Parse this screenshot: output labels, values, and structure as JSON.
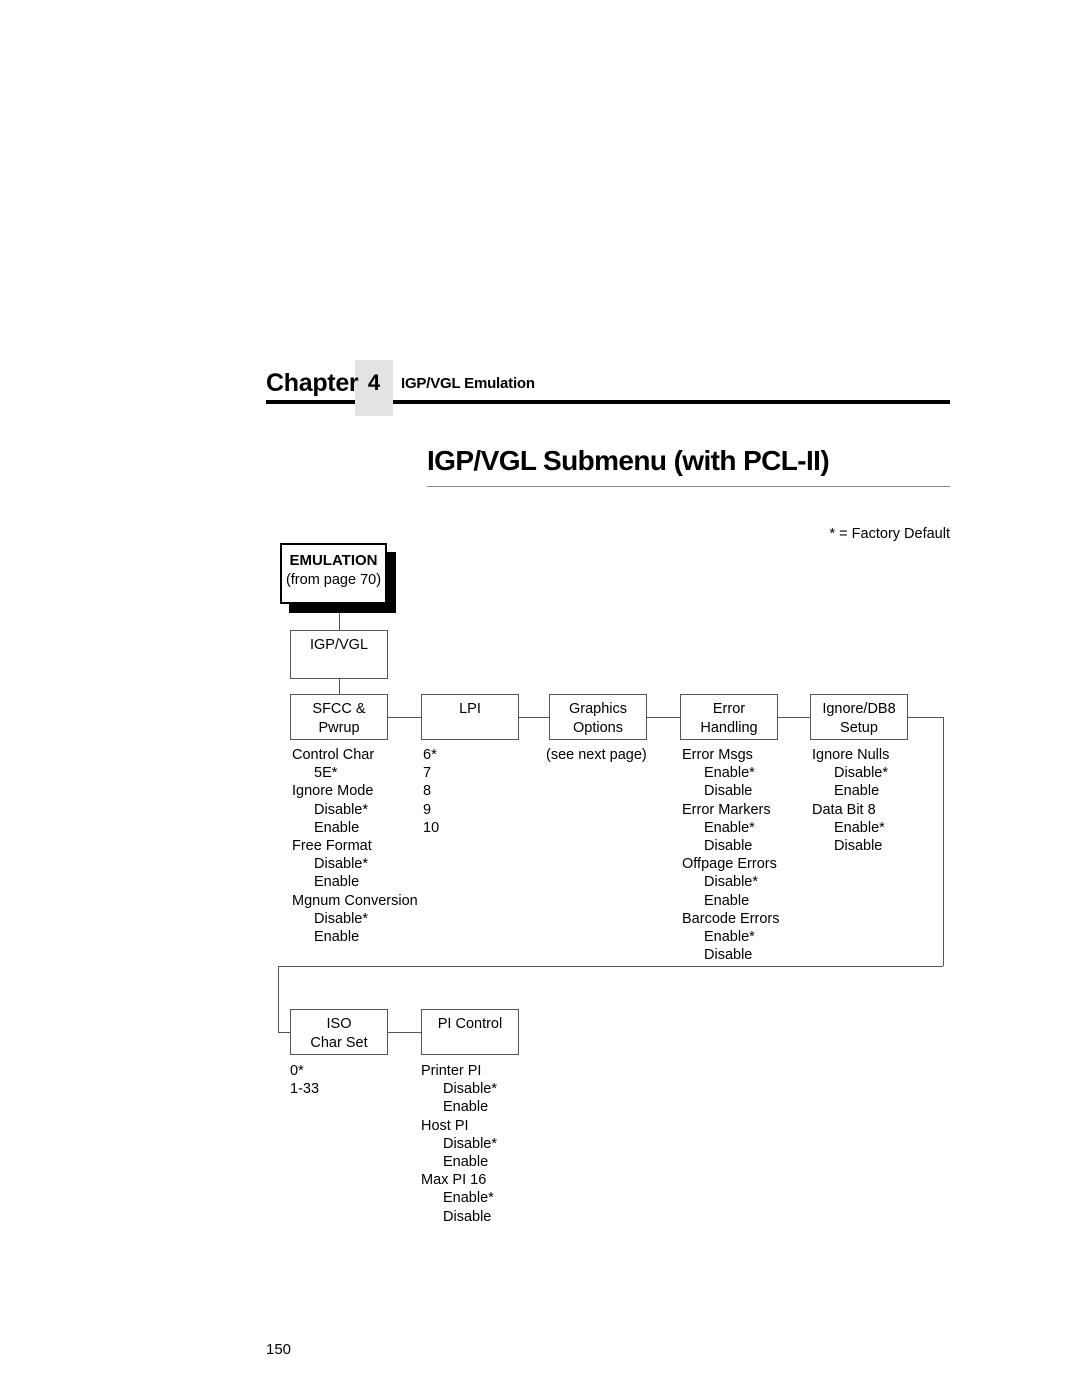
{
  "header": {
    "chapter_word": "Chapter",
    "chapter_number": "4",
    "chapter_title": "IGP/VGL Emulation"
  },
  "page": {
    "title": "IGP/VGL Submenu (with PCL-II)",
    "folio": "150",
    "legend_note": "* = Factory Default"
  },
  "diagram": {
    "root": {
      "label_line1": "EMULATION",
      "label_line2": "(from page 70)"
    },
    "branch": {
      "label_line1": "IGP/VGL",
      "label_line2": ""
    },
    "nodes": [
      {
        "id": "sfcc-pwrup",
        "line1": "SFCC &",
        "line2": "Pwrup"
      },
      {
        "id": "lpi",
        "line1": "LPI",
        "line2": ""
      },
      {
        "id": "graphics-options",
        "line1": "Graphics",
        "line2": "Options"
      },
      {
        "id": "error-handling",
        "line1": "Error",
        "line2": "Handling"
      },
      {
        "id": "ignore-db8-setup",
        "line1": "Ignore/DB8",
        "line2": "Setup"
      },
      {
        "id": "iso-char-set",
        "line1": "ISO",
        "line2": "Char Set"
      },
      {
        "id": "pi-control",
        "line1": "PI Control",
        "line2": ""
      }
    ],
    "columns": {
      "sfcc_pwrup": [
        {
          "text": "Control Char",
          "sub": false
        },
        {
          "text": "5E*",
          "sub": true
        },
        {
          "text": "Ignore Mode",
          "sub": false
        },
        {
          "text": "Disable*",
          "sub": true
        },
        {
          "text": "Enable",
          "sub": true
        },
        {
          "text": "Free Format",
          "sub": false
        },
        {
          "text": "Disable*",
          "sub": true
        },
        {
          "text": "Enable",
          "sub": true
        },
        {
          "text": "Mgnum Conversion",
          "sub": false
        },
        {
          "text": "Disable*",
          "sub": true
        },
        {
          "text": "Enable",
          "sub": true
        }
      ],
      "lpi": [
        {
          "text": "6*",
          "sub": false
        },
        {
          "text": "7",
          "sub": false
        },
        {
          "text": "8",
          "sub": false
        },
        {
          "text": "9",
          "sub": false
        },
        {
          "text": "10",
          "sub": false
        }
      ],
      "graphics_options": [
        {
          "text": "(see next page)",
          "sub": false
        }
      ],
      "error_handling": [
        {
          "text": "Error Msgs",
          "sub": false
        },
        {
          "text": "Enable*",
          "sub": true
        },
        {
          "text": "Disable",
          "sub": true
        },
        {
          "text": "Error Markers",
          "sub": false
        },
        {
          "text": "Enable*",
          "sub": true
        },
        {
          "text": "Disable",
          "sub": true
        },
        {
          "text": "Offpage Errors",
          "sub": false
        },
        {
          "text": "Disable*",
          "sub": true
        },
        {
          "text": "Enable",
          "sub": true
        },
        {
          "text": "Barcode Errors",
          "sub": false
        },
        {
          "text": "Enable*",
          "sub": true
        },
        {
          "text": "Disable",
          "sub": true
        }
      ],
      "ignore_db8_setup": [
        {
          "text": "Ignore Nulls",
          "sub": false
        },
        {
          "text": "Disable*",
          "sub": true
        },
        {
          "text": "Enable",
          "sub": true
        },
        {
          "text": "Data Bit 8",
          "sub": false
        },
        {
          "text": "Enable*",
          "sub": true
        },
        {
          "text": "Disable",
          "sub": true
        }
      ],
      "iso_char_set": [
        {
          "text": "0*",
          "sub": false
        },
        {
          "text": "1-33",
          "sub": false
        }
      ],
      "pi_control": [
        {
          "text": "Printer PI",
          "sub": false
        },
        {
          "text": "Disable*",
          "sub": true
        },
        {
          "text": "Enable",
          "sub": true
        },
        {
          "text": "Host PI",
          "sub": false
        },
        {
          "text": "Disable*",
          "sub": true
        },
        {
          "text": "Enable",
          "sub": true
        },
        {
          "text": "Max PI 16",
          "sub": false
        },
        {
          "text": "Enable*",
          "sub": true
        },
        {
          "text": "Disable",
          "sub": true
        }
      ]
    }
  }
}
